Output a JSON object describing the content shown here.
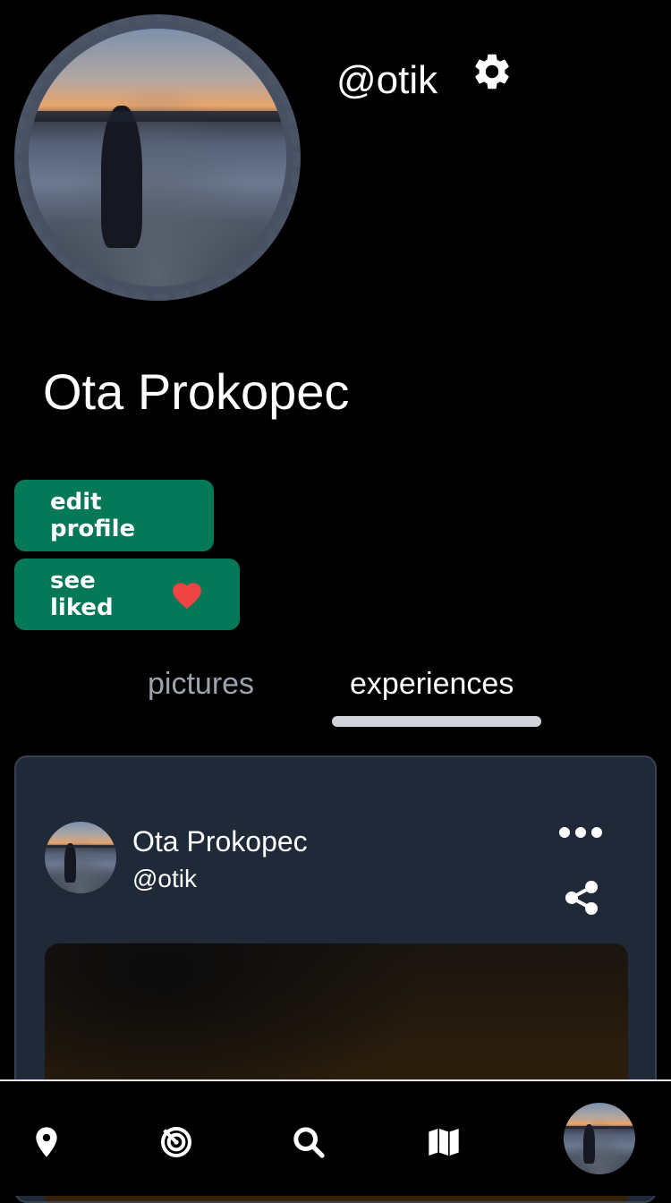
{
  "profile": {
    "username": "@otik",
    "full_name": "Ota Prokopec"
  },
  "buttons": {
    "edit_profile": "edit profile",
    "see_liked": "see liked"
  },
  "tabs": [
    {
      "label": "pictures",
      "active": false
    },
    {
      "label": "experiences",
      "active": true
    }
  ],
  "post": {
    "author_name": "Ota Prokopec",
    "author_handle": "@otik"
  },
  "nav": {
    "items": [
      "location-icon",
      "radar-icon",
      "search-icon",
      "map-icon",
      "profile-avatar"
    ]
  },
  "colors": {
    "background": "#000000",
    "button": "#047857",
    "card": "#1f2937",
    "heart": "#ef4444",
    "inactive_tab": "#9ca3af"
  }
}
